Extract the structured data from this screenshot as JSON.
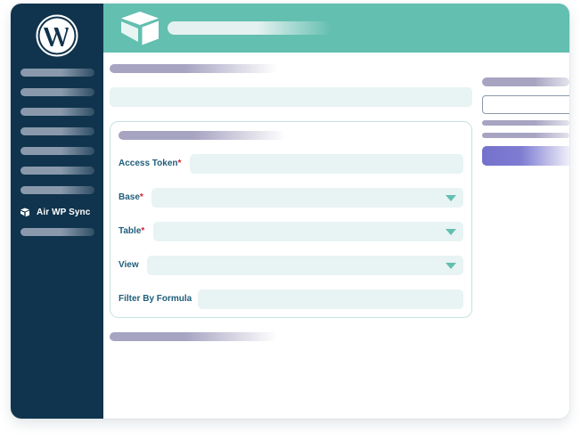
{
  "sidebar": {
    "active_item_label": "Air WP Sync"
  },
  "form": {
    "access_token_label": "Access Token",
    "base_label": "Base",
    "table_label": "Table",
    "view_label": "View",
    "filter_label": "Filter By Formula",
    "required_marker": "*"
  },
  "icons": {
    "wordpress": "wordpress-logo",
    "airtable": "airtable-logo",
    "active_item": "airtable-small-icon",
    "dropdown": "chevron-down-icon"
  },
  "colors": {
    "sidebar": "#10344d",
    "header": "#63bfb0",
    "label": "#1f5d7a",
    "required": "#d41f2f",
    "field_bg": "#e8f3f3",
    "accent_button": "#7371cc"
  }
}
